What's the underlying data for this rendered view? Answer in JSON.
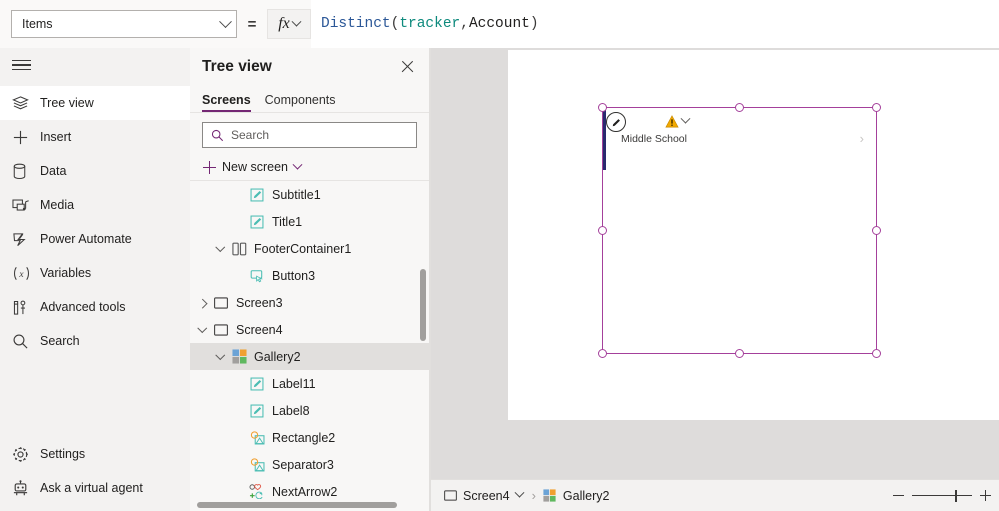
{
  "formula_bar": {
    "property": "Items",
    "equals": "=",
    "fx_label": "fx",
    "formula": "Distinct(tracker,Account)",
    "formula_tokens": [
      {
        "t": "Distinct",
        "k": "fn"
      },
      {
        "t": "(",
        "k": "punct"
      },
      {
        "t": "tracker",
        "k": "tbl"
      },
      {
        "t": ",",
        "k": "punct"
      },
      {
        "t": "Account",
        "k": "col"
      },
      {
        "t": ")",
        "k": "punct"
      }
    ]
  },
  "rail": {
    "hamburger": "hamburger-menu",
    "items": [
      {
        "label": "Tree view",
        "icon": "tree-view-icon",
        "active": true
      },
      {
        "label": "Insert",
        "icon": "plus-icon",
        "active": false
      },
      {
        "label": "Data",
        "icon": "database-icon",
        "active": false
      },
      {
        "label": "Media",
        "icon": "media-icon",
        "active": false
      },
      {
        "label": "Power Automate",
        "icon": "power-automate-icon",
        "active": false
      },
      {
        "label": "Variables",
        "icon": "variables-icon",
        "active": false
      },
      {
        "label": "Advanced tools",
        "icon": "advanced-tools-icon",
        "active": false
      },
      {
        "label": "Search",
        "icon": "search-icon",
        "active": false
      }
    ],
    "bottom_items": [
      {
        "label": "Settings",
        "icon": "gear-icon"
      },
      {
        "label": "Ask a virtual agent",
        "icon": "robot-icon"
      }
    ]
  },
  "tree_panel": {
    "title": "Tree view",
    "close": "close-icon",
    "tabs": [
      {
        "label": "Screens",
        "active": true
      },
      {
        "label": "Components",
        "active": false
      }
    ],
    "search_placeholder": "Search",
    "search_value": "",
    "new_screen_label": "New screen",
    "nodes": [
      {
        "label": "Subtitle1",
        "icon": "label-icon",
        "indent": 3,
        "expander": "none",
        "selected": false
      },
      {
        "label": "Title1",
        "icon": "label-icon",
        "indent": 3,
        "expander": "none",
        "selected": false
      },
      {
        "label": "FooterContainer1",
        "icon": "container-icon",
        "indent": 2,
        "expander": "down",
        "selected": false
      },
      {
        "label": "Button3",
        "icon": "button-icon",
        "indent": 3,
        "expander": "none",
        "selected": false
      },
      {
        "label": "Screen3",
        "icon": "screen-icon",
        "indent": 1,
        "expander": "right",
        "selected": false
      },
      {
        "label": "Screen4",
        "icon": "screen-icon",
        "indent": 1,
        "expander": "down",
        "selected": false
      },
      {
        "label": "Gallery2",
        "icon": "gallery-icon",
        "indent": 2,
        "expander": "down",
        "selected": true
      },
      {
        "label": "Label11",
        "icon": "label-icon",
        "indent": 3,
        "expander": "none",
        "selected": false
      },
      {
        "label": "Label8",
        "icon": "label-icon",
        "indent": 3,
        "expander": "none",
        "selected": false
      },
      {
        "label": "Rectangle2",
        "icon": "shape-icon",
        "indent": 3,
        "expander": "none",
        "selected": false
      },
      {
        "label": "Separator3",
        "icon": "shape-icon",
        "indent": 3,
        "expander": "none",
        "selected": false
      },
      {
        "label": "NextArrow2",
        "icon": "next-arrow-icon",
        "indent": 3,
        "expander": "none",
        "selected": false
      }
    ]
  },
  "canvas": {
    "gallery_item_label": "Middle School",
    "warning_icon": "warning-triangle-icon",
    "edit_icon": "pencil-edit-icon",
    "next_chevron": "›",
    "selection_color": "#a4409b"
  },
  "bottom_bar": {
    "screen_crumb": "Screen4",
    "control_crumb": "Gallery2",
    "separator": "›",
    "zoom_out": "minus-icon",
    "zoom_in": "plus-icon"
  },
  "colors": {
    "accent": "#742774",
    "selection": "#a4409b",
    "warning": "#f2a900",
    "rail_bg": "#f3f2f1",
    "canvas_bg": "#dedcdb"
  }
}
